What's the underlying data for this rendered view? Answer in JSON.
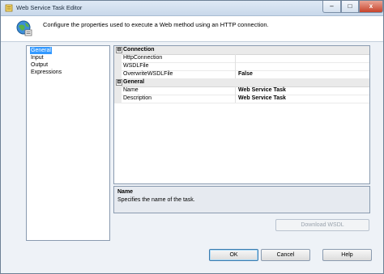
{
  "window": {
    "title": "Web Service Task Editor"
  },
  "header": {
    "text": "Configure the properties used to execute a Web method using an HTTP connection."
  },
  "nav": {
    "items": [
      "General",
      "Input",
      "Output",
      "Expressions"
    ],
    "selected": "General"
  },
  "grid": {
    "categories": [
      {
        "name": "Connection",
        "toggle": "⊟",
        "properties": [
          {
            "name": "HttpConnection",
            "value": ""
          },
          {
            "name": "WSDLFile",
            "value": ""
          },
          {
            "name": "OverwriteWSDLFile",
            "value": "False"
          }
        ]
      },
      {
        "name": "General",
        "toggle": "⊟",
        "properties": [
          {
            "name": "Name",
            "value": "Web Service Task"
          },
          {
            "name": "Description",
            "value": "Web Service Task"
          }
        ]
      }
    ]
  },
  "description": {
    "title": "Name",
    "text": "Specifies the name of the task."
  },
  "buttons": {
    "download": "Download WSDL",
    "ok": "OK",
    "cancel": "Cancel",
    "help": "Help"
  },
  "window_buttons": {
    "minimize": "–",
    "maximize": "□",
    "close": "x"
  },
  "colors": {
    "selection": "#3399ff",
    "close_button": "#c7432b"
  }
}
